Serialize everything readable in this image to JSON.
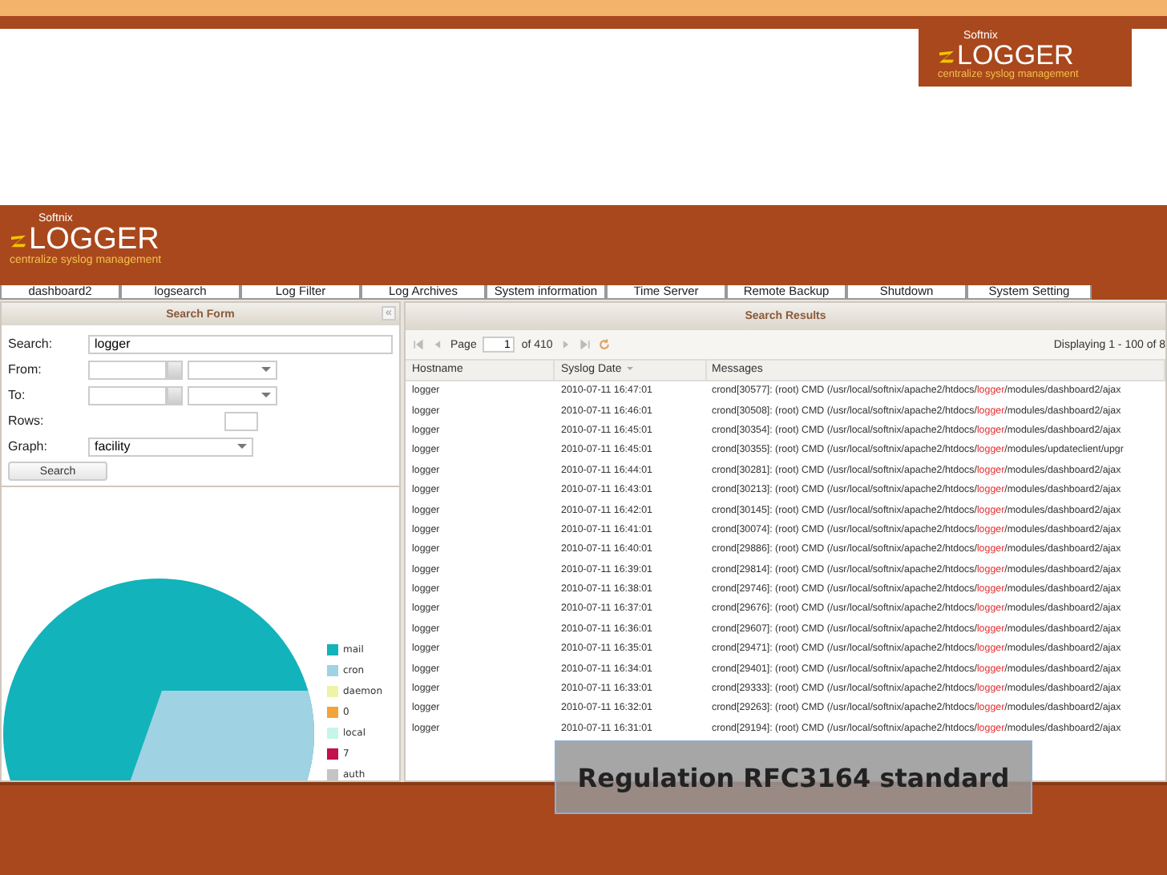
{
  "slide_logo": {
    "brand": "Softnix",
    "name": "LOGGER",
    "tagline": "centralize syslog management"
  },
  "app": {
    "logo": {
      "brand": "Softnix",
      "name": "LOGGER",
      "tagline": "centralize syslog management"
    },
    "tabs": [
      "dashboard2",
      "logsearch",
      "Log Filter",
      "Log Archives",
      "System information",
      "Time Server",
      "Remote Backup",
      "Shutdown",
      "System Setting"
    ],
    "search_form": {
      "title": "Search Form",
      "collapse": "«",
      "fields": [
        {
          "kind": "text",
          "label": "Search:",
          "value": "logger"
        },
        {
          "kind": "date",
          "label": "From:"
        },
        {
          "kind": "date",
          "label": "To:"
        },
        {
          "kind": "small",
          "label": "Rows:"
        },
        {
          "kind": "select",
          "label": "Graph:",
          "value": "facility"
        }
      ],
      "button": "Search",
      "legend": [
        {
          "label": "mail",
          "color": "#12b3ba"
        },
        {
          "label": "cron",
          "color": "#9fd2e2"
        },
        {
          "label": "daemon",
          "color": "#eef3a6"
        },
        {
          "label": "0",
          "color": "#f2a33a"
        },
        {
          "label": "local",
          "color": "#c6f5ea"
        },
        {
          "label": "7",
          "color": "#c2104c"
        },
        {
          "label": "auth",
          "color": "#c4c4c4"
        }
      ]
    },
    "results": {
      "title": "Search Results",
      "page_label": "Page",
      "page": "1",
      "of": "of 410",
      "displaying": "Displaying 1 - 100 of 8",
      "columns": [
        {
          "label": "Hostname",
          "sorted": false
        },
        {
          "label": "Syslog Date",
          "sorted": true
        },
        {
          "label": "Messages",
          "sorted": false
        }
      ],
      "rows": [
        {
          "hostname": "logger",
          "date": "2010-07-11 16:47:01",
          "message": [
            "crond[30577]: (root) CMD (/usr/local/softnix/apache2/htdocs/",
            "logger",
            "/modules/dashboard2/ajax"
          ]
        },
        {
          "hostname": "logger",
          "date": "2010-07-11 16:46:01",
          "message": [
            "crond[30508]: (root) CMD (/usr/local/softnix/apache2/htdocs/",
            "logger",
            "/modules/dashboard2/ajax"
          ]
        },
        {
          "hostname": "logger",
          "date": "2010-07-11 16:45:01",
          "message": [
            "crond[30354]: (root) CMD (/usr/local/softnix/apache2/htdocs/",
            "logger",
            "/modules/dashboard2/ajax"
          ]
        },
        {
          "hostname": "logger",
          "date": "2010-07-11 16:45:01",
          "message": [
            "crond[30355]: (root) CMD (/usr/local/softnix/apache2/htdocs/",
            "logger",
            "/modules/updateclient/upgr"
          ]
        },
        {
          "hostname": "logger",
          "date": "2010-07-11 16:44:01",
          "message": [
            "crond[30281]: (root) CMD (/usr/local/softnix/apache2/htdocs/",
            "logger",
            "/modules/dashboard2/ajax"
          ]
        },
        {
          "hostname": "logger",
          "date": "2010-07-11 16:43:01",
          "message": [
            "crond[30213]: (root) CMD (/usr/local/softnix/apache2/htdocs/",
            "logger",
            "/modules/dashboard2/ajax"
          ]
        },
        {
          "hostname": "logger",
          "date": "2010-07-11 16:42:01",
          "message": [
            "crond[30145]: (root) CMD (/usr/local/softnix/apache2/htdocs/",
            "logger",
            "/modules/dashboard2/ajax"
          ]
        },
        {
          "hostname": "logger",
          "date": "2010-07-11 16:41:01",
          "message": [
            "crond[30074]: (root) CMD (/usr/local/softnix/apache2/htdocs/",
            "logger",
            "/modules/dashboard2/ajax"
          ]
        },
        {
          "hostname": "logger",
          "date": "2010-07-11 16:40:01",
          "message": [
            "crond[29886]: (root) CMD (/usr/local/softnix/apache2/htdocs/",
            "logger",
            "/modules/dashboard2/ajax"
          ]
        },
        {
          "hostname": "logger",
          "date": "2010-07-11 16:39:01",
          "message": [
            "crond[29814]: (root) CMD (/usr/local/softnix/apache2/htdocs/",
            "logger",
            "/modules/dashboard2/ajax"
          ]
        },
        {
          "hostname": "logger",
          "date": "2010-07-11 16:38:01",
          "message": [
            "crond[29746]: (root) CMD (/usr/local/softnix/apache2/htdocs/",
            "logger",
            "/modules/dashboard2/ajax"
          ]
        },
        {
          "hostname": "logger",
          "date": "2010-07-11 16:37:01",
          "message": [
            "crond[29676]: (root) CMD (/usr/local/softnix/apache2/htdocs/",
            "logger",
            "/modules/dashboard2/ajax"
          ]
        },
        {
          "hostname": "logger",
          "date": "2010-07-11 16:36:01",
          "message": [
            "crond[29607]: (root) CMD (/usr/local/softnix/apache2/htdocs/",
            "logger",
            "/modules/dashboard2/ajax"
          ]
        },
        {
          "hostname": "logger",
          "date": "2010-07-11 16:35:01",
          "message": [
            "crond[29471]: (root) CMD (/usr/local/softnix/apache2/htdocs/",
            "logger",
            "/modules/dashboard2/ajax"
          ]
        },
        {
          "hostname": "logger",
          "date": "2010-07-11 16:34:01",
          "message": [
            "crond[29401]: (root) CMD (/usr/local/softnix/apache2/htdocs/",
            "logger",
            "/modules/dashboard2/ajax"
          ]
        },
        {
          "hostname": "logger",
          "date": "2010-07-11 16:33:01",
          "message": [
            "crond[29333]: (root) CMD (/usr/local/softnix/apache2/htdocs/",
            "logger",
            "/modules/dashboard2/ajax"
          ]
        },
        {
          "hostname": "logger",
          "date": "2010-07-11 16:32:01",
          "message": [
            "crond[29263]: (root) CMD (/usr/local/softnix/apache2/htdocs/",
            "logger",
            "/modules/dashboard2/ajax"
          ]
        },
        {
          "hostname": "logger",
          "date": "2010-07-11 16:31:01",
          "message": [
            "crond[29194]: (root) CMD (/usr/local/softnix/apache2/htdocs/",
            "logger",
            "/modules/dashboard2/ajax"
          ]
        }
      ]
    }
  },
  "caption": "Regulation RFC3164 standard"
}
